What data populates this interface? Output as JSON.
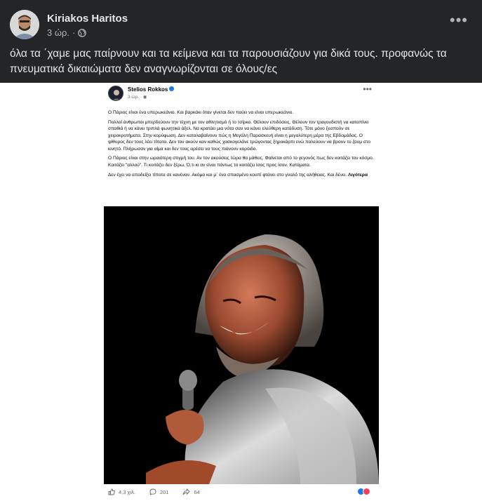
{
  "post": {
    "author": "Kiriakos Haritos",
    "time": "3 ώρ.",
    "separator": "·",
    "more_icon": "•••",
    "text": "όλα τα ΄χαμε μας παίρνουν και τα κείμενα και τα παρουσιάζουν για δικά τους. προφανώς τα πνευματικά δικαιώματα δεν αναγνωρίζονται σε όλους/ες"
  },
  "shared": {
    "author": "Stelios Rokkos",
    "time": "3 ώρ.",
    "separator": "·",
    "more_icon": "•••",
    "paragraphs": [
      "Ο Πάριος είναι ένα υπερωκεάνιο. Και βαρκάκι όταν γίνεται δεν παύει να είναι υπερωκεάνιο.",
      "Πολλοί άνθρωποι μπερδεύουν την τέχνη με τον αθλητισμό ή το τσίρκο. Θέλουν επιδόσεις. Θέλουν τον τραγουδιστή να καταπίνει σπαθιά ή να κάνει τριπλά φωνητικά άξελ. Να κρατάει μια νότα σαν να κάνει ελεύθερη κατάδυση. Τότε μόνο ξεσπούν σε χειροκροτήματα. Στην κορύφωση. Δεν καταλαβαίνουν πώς η Μεγάλη Παρασκευή είναι η μεγαλύτερη μέρα της Εβδομάδας. Ο ψίθυρος δεν τους λέει τίποτα. Δεν τον ακούν καν καθώς χασκογελάνε τρώγοντας ξηροκάρπι ενώ παλεύουν να βρουν το ζουμ στο κινητό. Πλήρωσαν για αίμα και δεν τους αρέσει να τους πιάνουν κορόιδο.",
      "Ο Πάριος είναι στην ωραιότερη στιγμή του. Αν τον ακούσεις τώρα θα μάθεις. Φαίνεται από το γεγονός πως δεν κοιτάζει τον κόσμο. Κοιτάζει \"αλλού\". Τι κοιτάζει δεν ξέρω, Ό,τι κι αν είναι πάντως το κοιτάζει ίσος προς ίσον. Κατάματα."
    ],
    "last_paragraph": "Δεν έχει να αποδείξει τίποτα σε κανέναν. Ακόμα και μ΄ ένα σπασμένο κουπί φτάνει στο γυαλό της αλήθειας. Και δένει.",
    "see_more": "Λιγότερα",
    "likes": "4,3 χιλ.",
    "comments": "201",
    "shares": "64"
  },
  "icons": {
    "globe": "globe-icon",
    "like": "thumbs-up-icon",
    "comment": "comment-icon",
    "share": "share-icon",
    "verified": "verified-badge-icon"
  },
  "colors": {
    "background": "#242526",
    "text": "#e4e6eb",
    "secondary_text": "#b0b3b8",
    "verified": "#1877f2"
  }
}
